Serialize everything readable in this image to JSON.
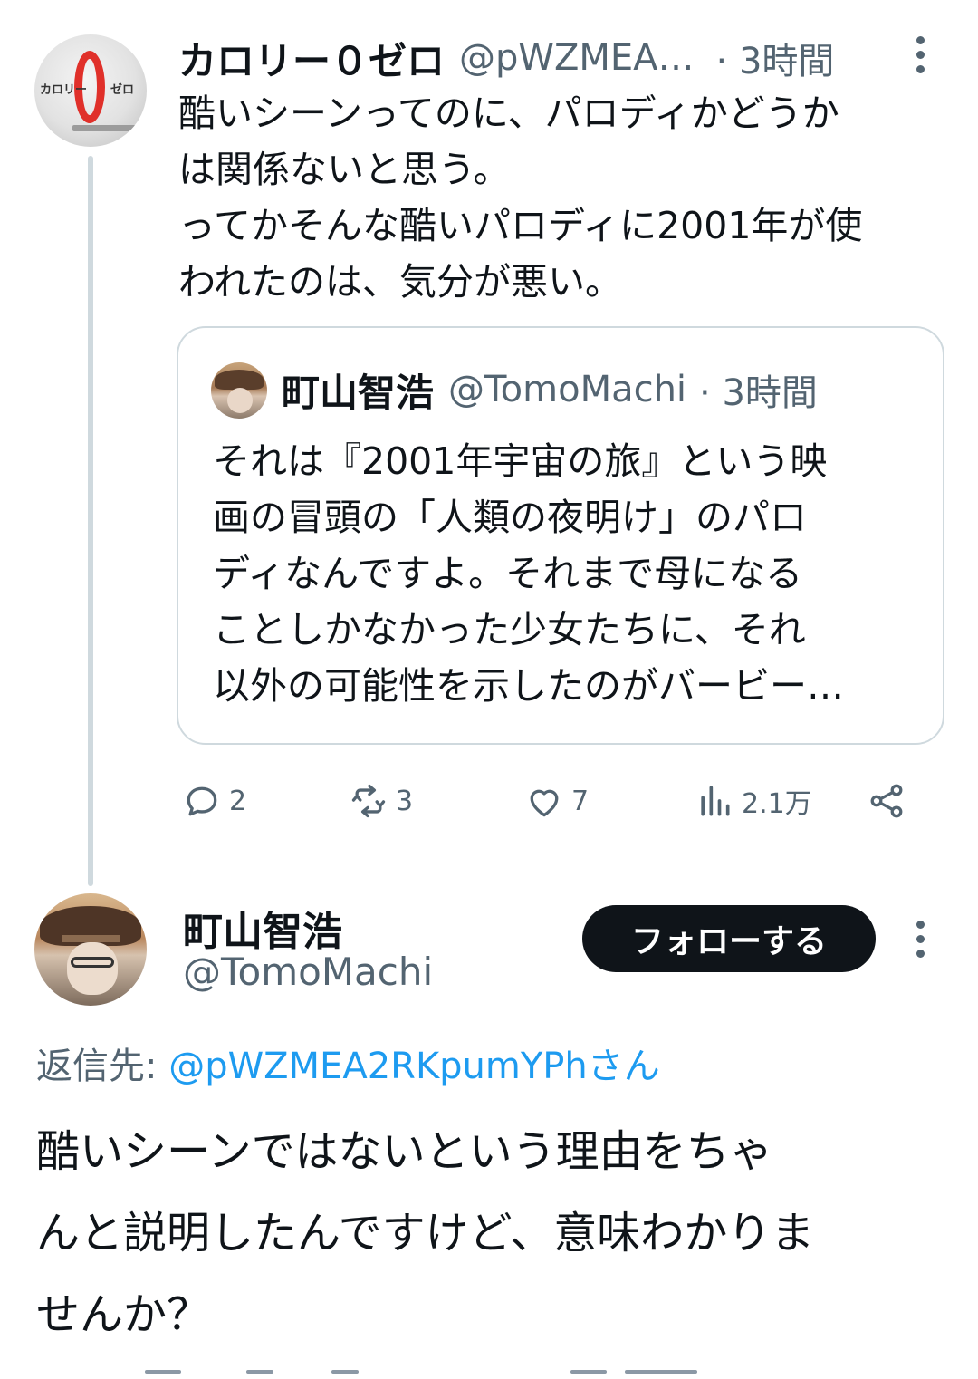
{
  "parent_tweet": {
    "display_name": "カロリー０ゼロ",
    "handle": "@pWZMEA…",
    "time": "· 3時間",
    "avatar_logo_left": "カロリー",
    "avatar_logo_right": "ゼロ",
    "text_lines": [
      "酷いシーンってのに、パロディかどうか",
      "は関係ないと思う。",
      "ってかそんな酷いパロディに2001年が使",
      "われたのは、気分が悪い。"
    ]
  },
  "quoted_tweet": {
    "display_name": "町山智浩",
    "handle": "@TomoMachi",
    "time": "· 3時間",
    "text_lines": [
      "それは『2001年宇宙の旅』という映",
      "画の冒頭の「人類の夜明け」のパロ",
      "ディなんですよ。それまで母になる",
      "ことしかなかった少女たちに、それ",
      "以外の可能性を示したのがバービー…"
    ]
  },
  "actions": {
    "reply_count": "2",
    "retweet_count": "3",
    "like_count": "7",
    "views_count": "2.1万"
  },
  "focused_tweet": {
    "display_name": "町山智浩",
    "handle": "@TomoMachi",
    "follow_label": "フォローする",
    "reply_to_prefix": "返信先: ",
    "reply_to_mention": "@pWZMEA2RKpumYPhさん",
    "text_lines": [
      "酷いシーンではないという理由をちゃ",
      "んと説明したんですけど、意味わかりま",
      "せんか？"
    ]
  },
  "icons": {
    "reply": "reply-icon",
    "retweet": "retweet-icon",
    "like": "heart-icon",
    "views": "views-icon",
    "share": "share-icon",
    "more": "more-icon"
  },
  "colors": {
    "text": "#0f1419",
    "secondary": "#536471",
    "link": "#1d9bf0",
    "border": "#cfd9de",
    "follow_button": "#0f1419"
  }
}
